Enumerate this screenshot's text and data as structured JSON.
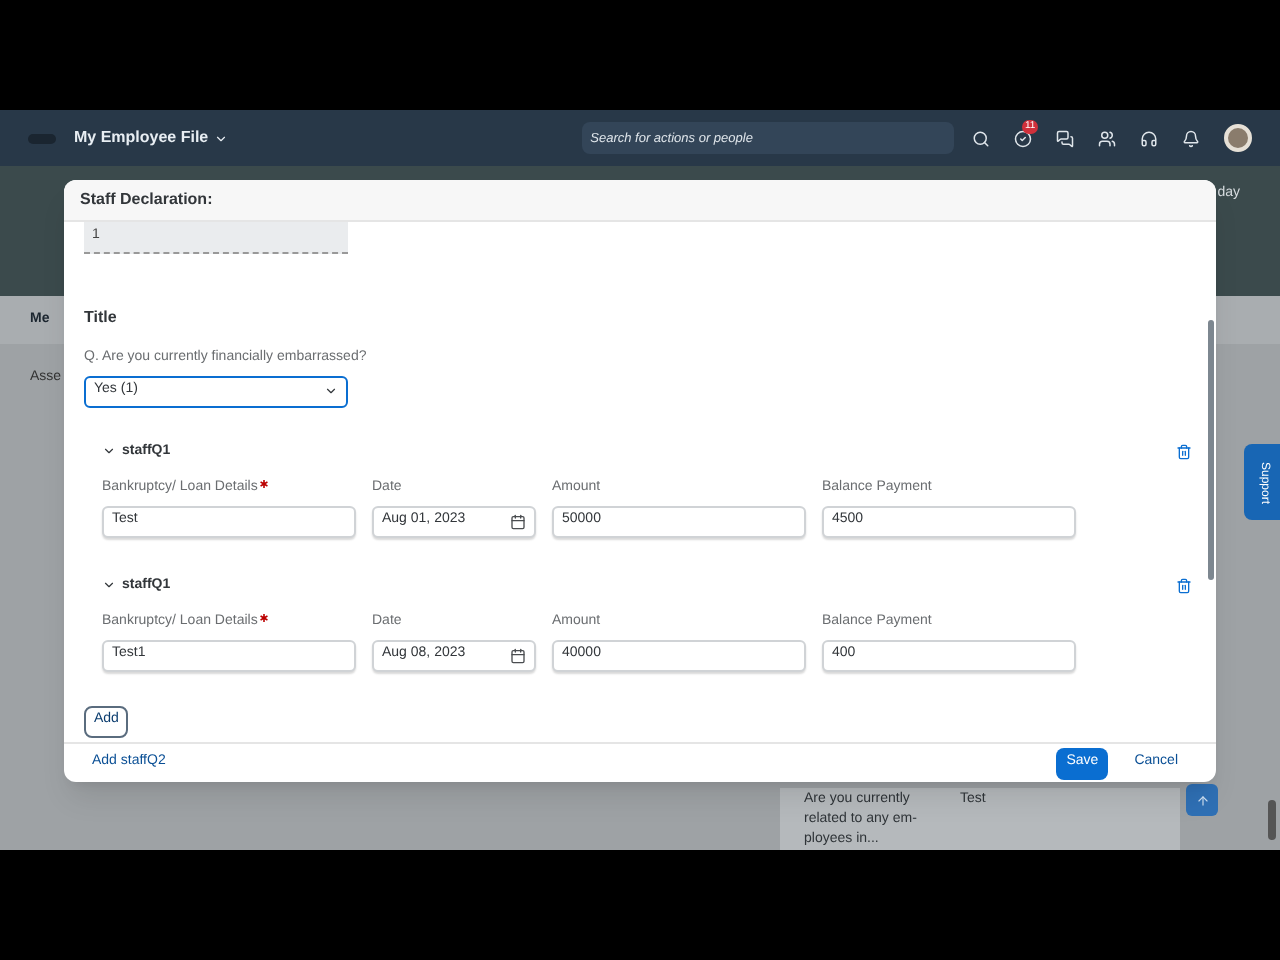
{
  "header": {
    "title": "My Employee File",
    "search": {
      "placeholder": "Search for actions or people"
    },
    "notification_badge": "11"
  },
  "background": {
    "tabs": [
      {
        "label": "Me",
        "selected": true
      }
    ],
    "side_text": "Asse",
    "banner_text": "day",
    "card": {
      "question": "Are you currently related to any em-ployees in...",
      "answer": "Test"
    },
    "support_tab": "Support"
  },
  "dialog": {
    "title": "Staff Declaration:",
    "first_field": {
      "value": "1",
      "disabled": true
    },
    "section_title": "Title",
    "question": {
      "label": "Q. Are you currently financially embarrassed?",
      "value": "Yes (1)",
      "focused": true
    },
    "groups": [
      {
        "title": "staffQ1",
        "expanded": true,
        "fields": [
          {
            "label": "Bankruptcy/ Loan Details",
            "required": true,
            "kind": "text",
            "value": "Test"
          },
          {
            "label": "Date",
            "required": false,
            "kind": "date",
            "value": "Aug 01, 2023"
          },
          {
            "label": "Amount",
            "required": false,
            "kind": "text",
            "value": "50000"
          },
          {
            "label": "Balance Payment",
            "required": false,
            "kind": "text",
            "value": "4500"
          }
        ]
      },
      {
        "title": "staffQ1",
        "expanded": true,
        "fields": [
          {
            "label": "Bankruptcy/ Loan Details",
            "required": true,
            "kind": "text",
            "value": "Test1"
          },
          {
            "label": "Date",
            "required": false,
            "kind": "date",
            "value": "Aug 08, 2023"
          },
          {
            "label": "Amount",
            "required": false,
            "kind": "text",
            "value": "40000"
          },
          {
            "label": "Balance Payment",
            "required": false,
            "kind": "text",
            "value": "400"
          }
        ]
      }
    ],
    "add_button": "Add",
    "footer": {
      "link": "Add staffQ2",
      "buttons": [
        {
          "label": "Save",
          "kind": "primary"
        },
        {
          "label": "Cancel",
          "kind": "plain"
        }
      ]
    }
  }
}
